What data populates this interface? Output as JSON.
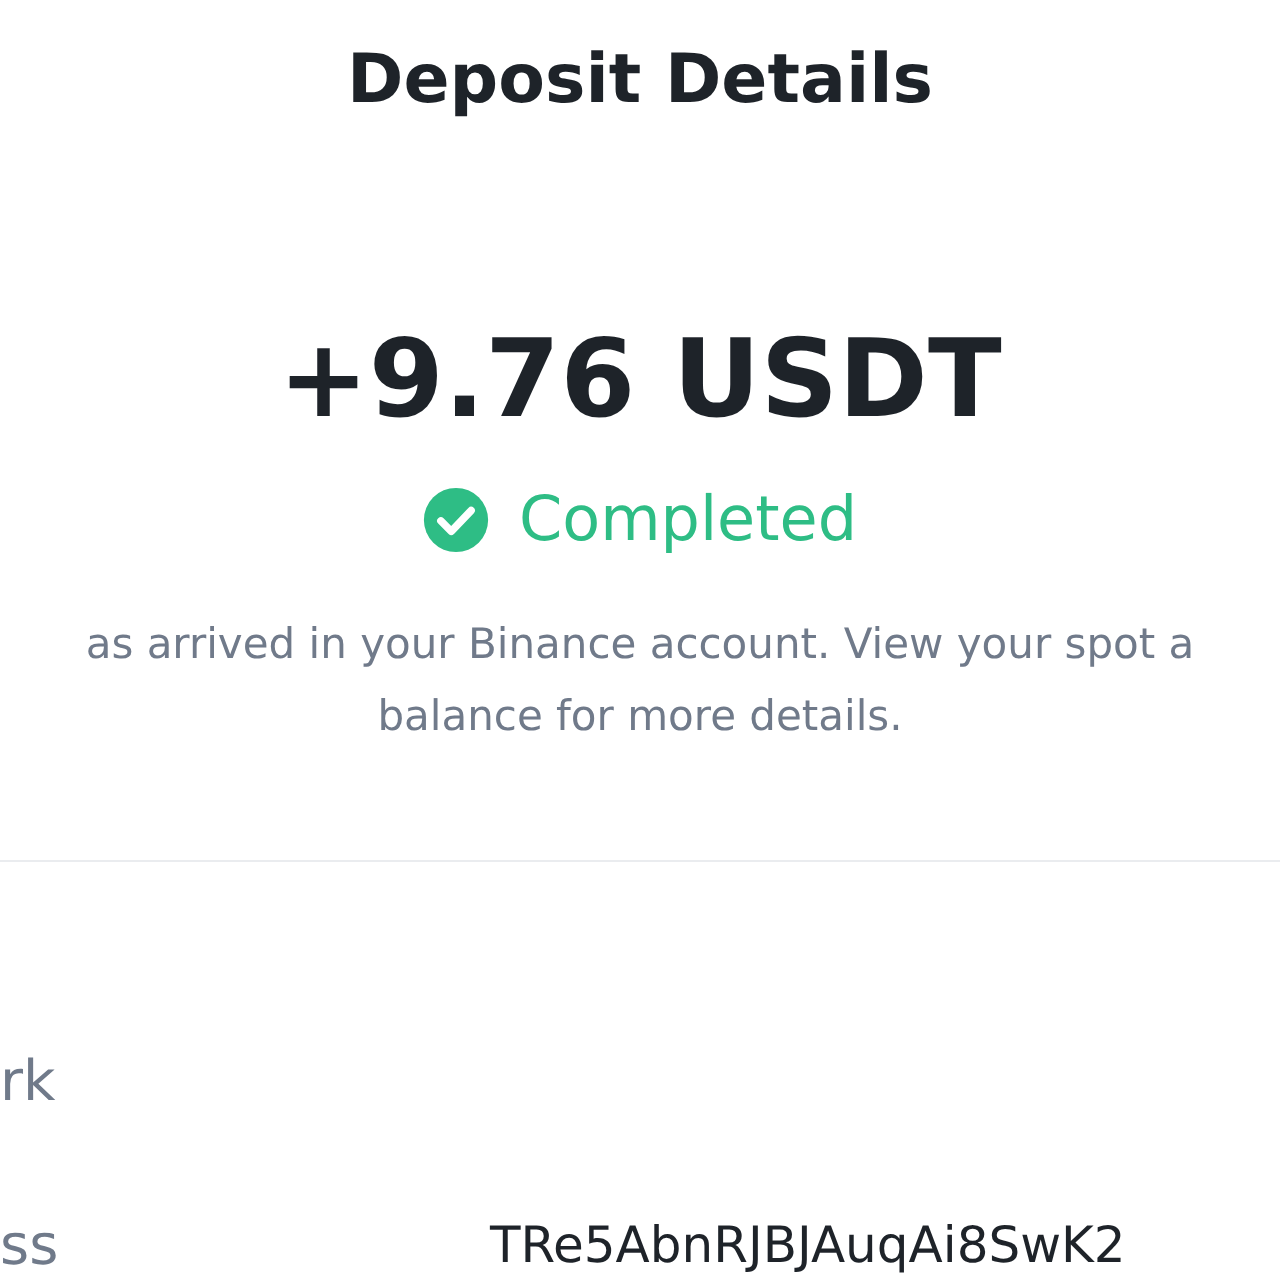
{
  "title": "Deposit Details",
  "amount": "+9.76 USDT",
  "status": {
    "kind": "completed",
    "label": "Completed"
  },
  "message_lines": [
    "as arrived in your Binance account. View your spot a",
    "balance for more details."
  ],
  "rows": [
    {
      "label": "rk"
    },
    {
      "label": "ss",
      "value": "TRe5AbnRJBJAuqAi8SwK2"
    }
  ]
}
